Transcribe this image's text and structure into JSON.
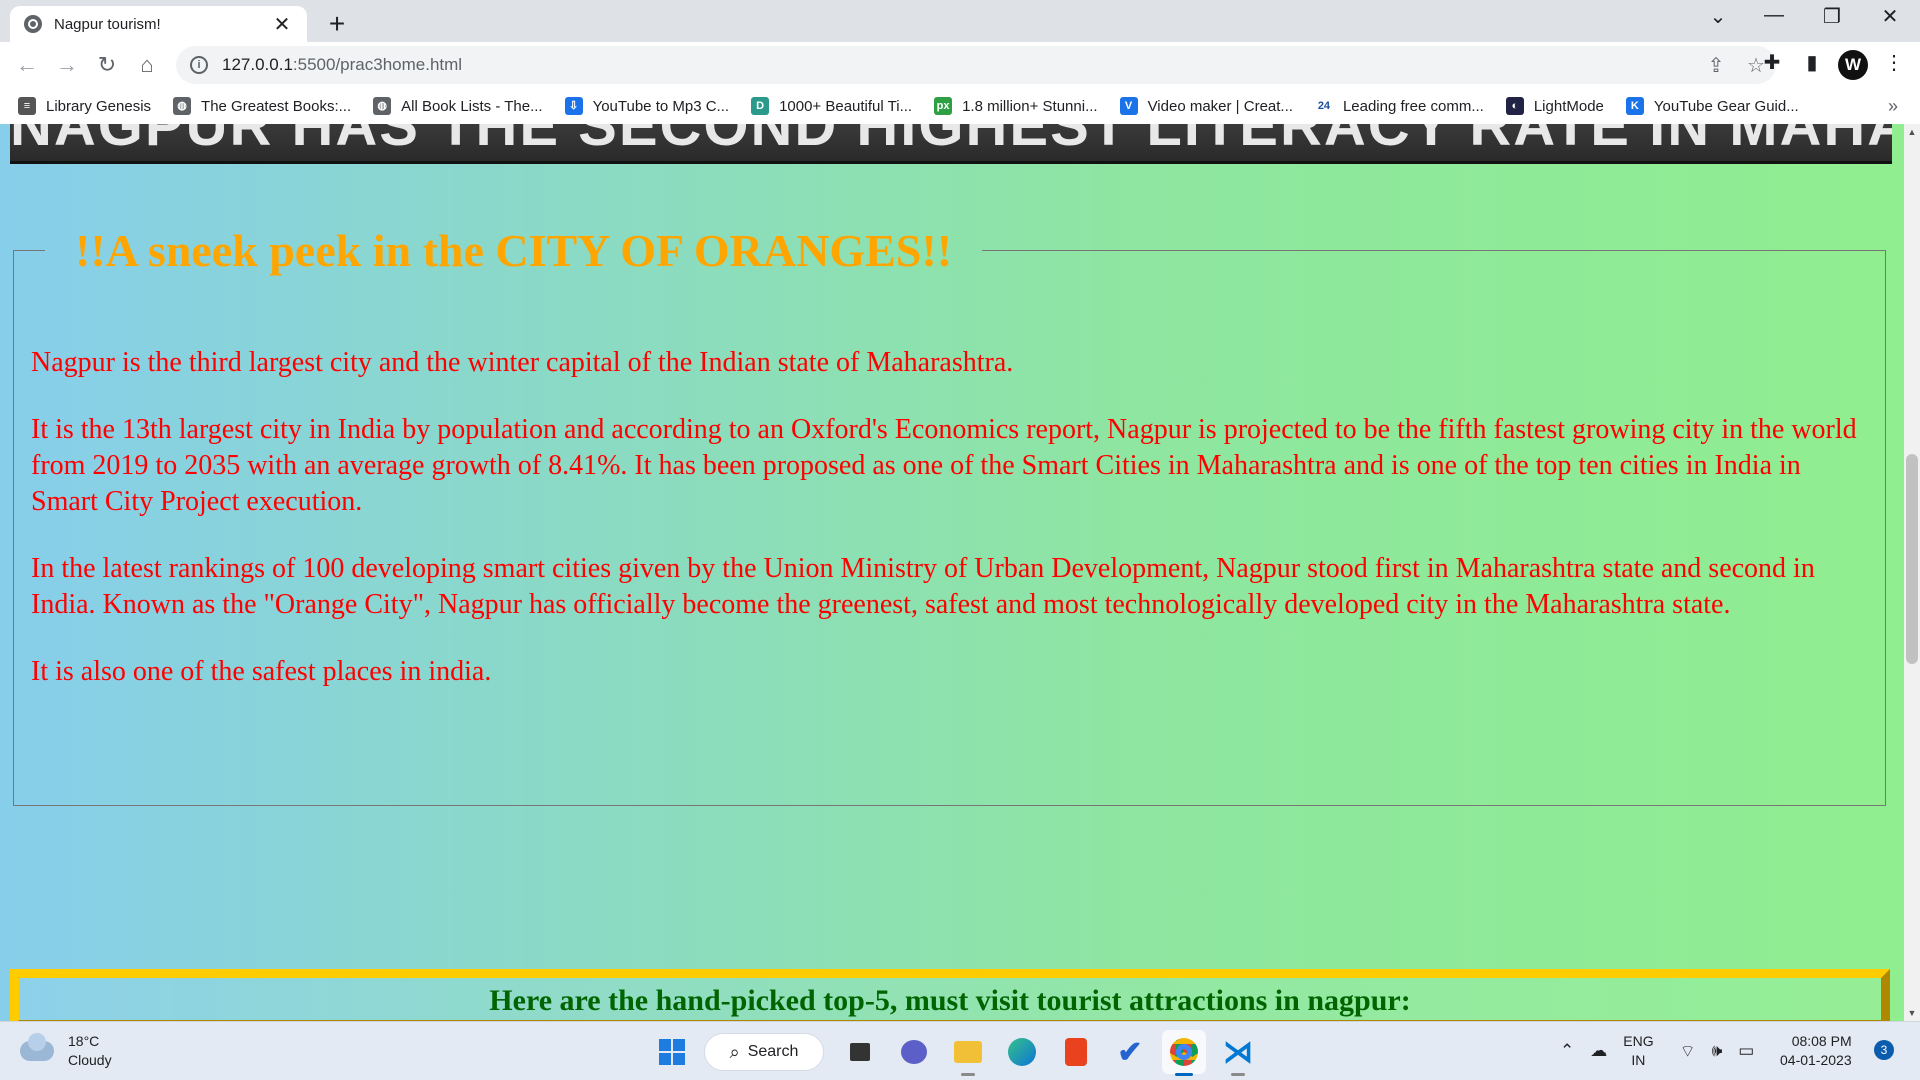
{
  "browser": {
    "tab": {
      "title": "Nagpur tourism!",
      "close": "✕"
    },
    "new_tab": "+",
    "window_controls": {
      "list": "⌄",
      "minimize": "—",
      "restore": "❐",
      "close": "✕"
    },
    "nav": {
      "back": "←",
      "forward": "→",
      "reload": "↻",
      "home": "⌂"
    },
    "url": {
      "host": "127.0.0.1",
      "path": ":5500/prac3home.html"
    },
    "profile_initial": "W"
  },
  "bookmarks": [
    {
      "label": "Library Genesis",
      "icon": "library-genesis-icon",
      "color": "#555555",
      "glyph": "≡"
    },
    {
      "label": "The Greatest Books:...",
      "icon": "globe-icon",
      "color": "#5f6368",
      "glyph": "◍"
    },
    {
      "label": "All Book Lists - The...",
      "icon": "globe-icon",
      "color": "#5f6368",
      "glyph": "◍"
    },
    {
      "label": "YouTube to Mp3 C...",
      "icon": "download-cloud-icon",
      "color": "#1a73e8",
      "glyph": "⇩"
    },
    {
      "label": "1000+ Beautiful Ti...",
      "icon": "unsplash-icon",
      "color": "#2c9a8a",
      "glyph": "D"
    },
    {
      "label": "1.8 million+ Stunni...",
      "icon": "pixabay-icon",
      "color": "#2ea043",
      "glyph": "px"
    },
    {
      "label": "Video maker | Creat...",
      "icon": "vimeo-icon",
      "color": "#1a73e8",
      "glyph": "V"
    },
    {
      "label": "Leading free comm...",
      "icon": "24-icon",
      "color": "#ffffff",
      "glyph": "24"
    },
    {
      "label": "LightMode",
      "icon": "lightmode-icon",
      "color": "#222244",
      "glyph": "◐"
    },
    {
      "label": "YouTube Gear Guid...",
      "icon": "kit-icon",
      "color": "#1a73e8",
      "glyph": "K"
    }
  ],
  "bookmarks_more": "»",
  "page": {
    "banner_text": "NAGPUR HAS THE SECOND HIGHEST LITERACY RATE IN MAHARASHTRA",
    "legend": "!!A sneek peek in the CITY OF ORANGES!!",
    "paragraphs": [
      "Nagpur is the third largest city and the winter capital of the Indian state of Maharashtra.",
      "It is the 13th largest city in India by population and according to an Oxford's Economics report, Nagpur is projected to be the fifth fastest growing city in the world from 2019 to 2035 with an average growth of 8.41%. It has been proposed as one of the Smart Cities in Maharashtra and is one of the top ten cities in India in Smart City Project execution.",
      "In the latest rankings of 100 developing smart cities given by the Union Ministry of Urban Development, Nagpur stood first in Maharashtra state and second in India. Known as the \"Orange City\", Nagpur has officially become the greenest, safest and most technologically developed city in the Maharashtra state.",
      "It is also one of the safest places in india."
    ],
    "attractions_heading": "Here are the hand-picked top-5, must visit tourist attractions in nagpur:"
  },
  "taskbar": {
    "weather": {
      "temp": "18°C",
      "condition": "Cloudy"
    },
    "search_label": "Search",
    "lang": {
      "line1": "ENG",
      "line2": "IN"
    },
    "time": "08:08 PM",
    "date": "04-01-2023",
    "notifications": "3"
  },
  "colors": {
    "legend": "#ffa500",
    "paragraph": "#ff0000",
    "attractions_heading": "#006400",
    "attractions_border": "#ffcc00",
    "gradient_start": "#87ceeb",
    "gradient_end": "#90ee90"
  }
}
